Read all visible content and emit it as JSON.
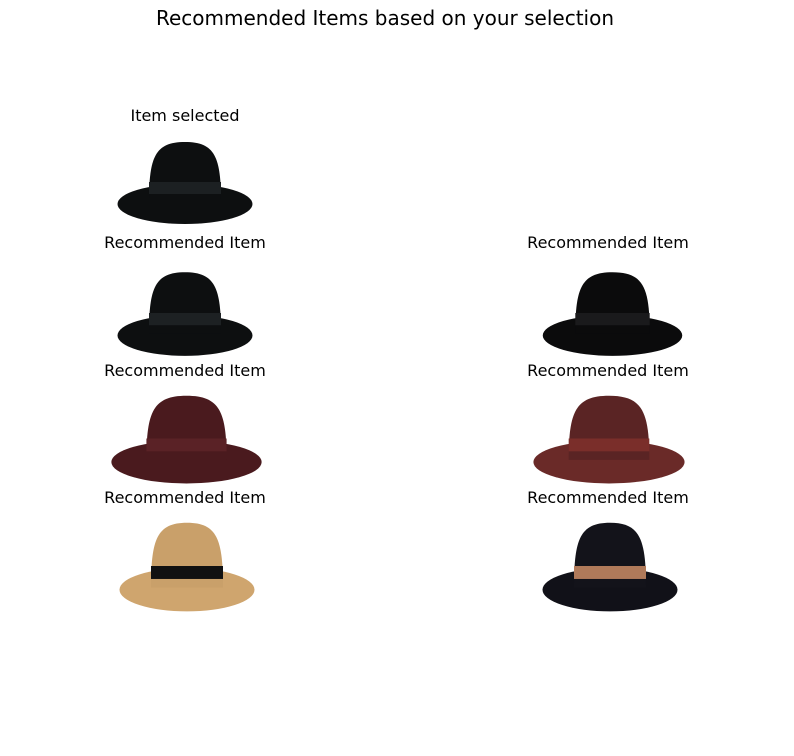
{
  "figure": {
    "title": "Recommended Items based on your selection",
    "selected": {
      "label": "Item selected",
      "hat": {
        "crown": "#0d0f10",
        "band": "#1c2022",
        "brim": "#0d0f10"
      }
    },
    "recommendations": [
      {
        "label": "Recommended Item",
        "hat": {
          "crown": "#0d0f10",
          "band": "#1d2123",
          "brim": "#0d0f10"
        }
      },
      {
        "label": "Recommended Item",
        "hat": {
          "crown": "#0b0b0c",
          "band": "#1a1a1c",
          "brim": "#0b0b0c"
        }
      },
      {
        "label": "Recommended Item",
        "hat": {
          "crown": "#4a1a1e",
          "band": "#5a2226",
          "brim": "#4a1a1e"
        }
      },
      {
        "label": "Recommended Item",
        "hat": {
          "crown": "#5a2424",
          "band": "#7a2e2a",
          "brim": "#6a2a28"
        }
      },
      {
        "label": "Recommended Item",
        "hat": {
          "crown": "#c9a06a",
          "band": "#111111",
          "brim": "#cfa56e"
        }
      },
      {
        "label": "Recommended Item",
        "hat": {
          "crown": "#13131a",
          "band": "#b07a5a",
          "brim": "#111118"
        }
      }
    ]
  }
}
